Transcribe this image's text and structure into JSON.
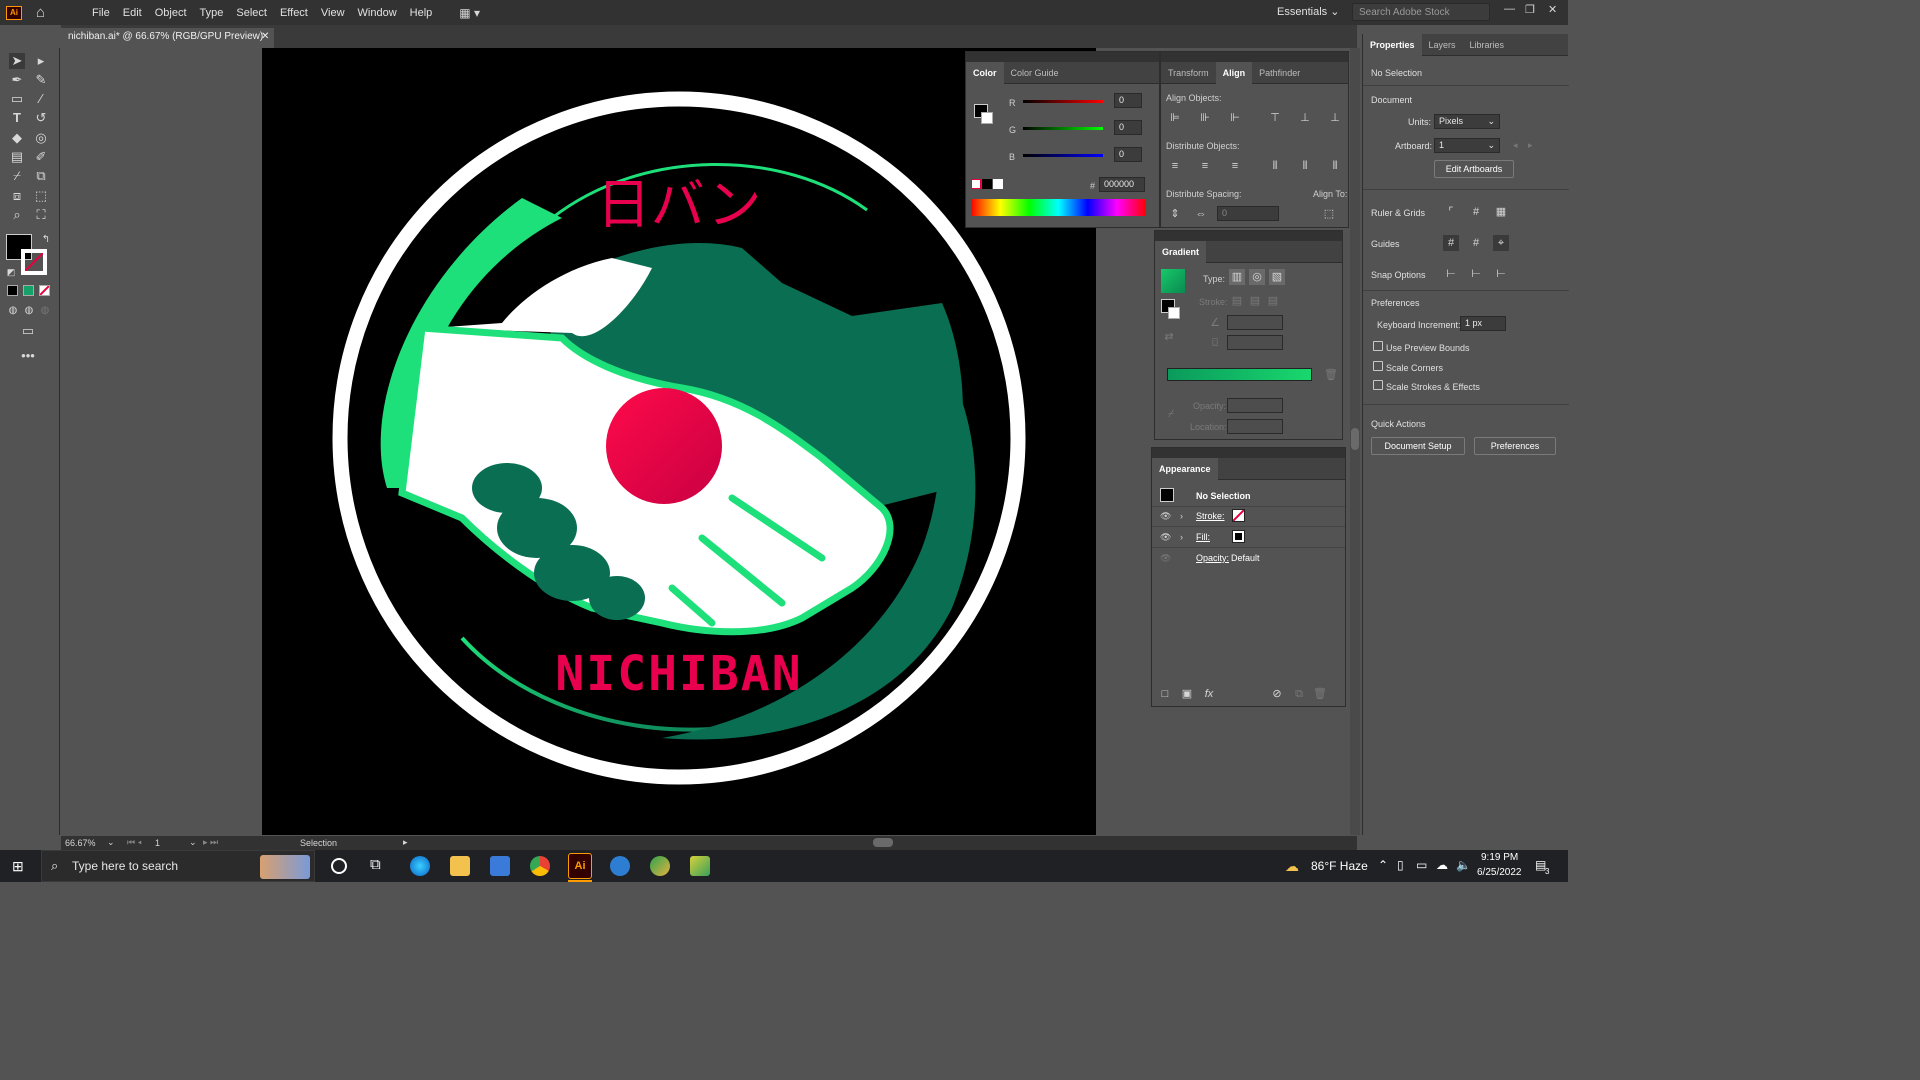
{
  "app": {
    "logo_text": "Ai"
  },
  "menu": [
    "File",
    "Edit",
    "Object",
    "Type",
    "Select",
    "Effect",
    "View",
    "Window",
    "Help"
  ],
  "workspace": {
    "label": "Essentials"
  },
  "stock_search": {
    "placeholder": "Search Adobe Stock"
  },
  "document_tab": {
    "title": "nichiban.ai* @ 66.67% (RGB/GPU Preview)"
  },
  "artwork": {
    "kanji": "日バン",
    "brand": "NICHIBAN",
    "colors": {
      "green_light": "#1ee07a",
      "green_dark": "#0a6e52",
      "red": "#e8004f",
      "white": "#ffffff",
      "black": "#000000"
    }
  },
  "status_bar": {
    "zoom": "66.67%",
    "artboard": "1",
    "tool": "Selection"
  },
  "color_panel": {
    "tabs": [
      "Color",
      "Color Guide"
    ],
    "channels": [
      {
        "label": "R",
        "value": "0"
      },
      {
        "label": "G",
        "value": "0"
      },
      {
        "label": "B",
        "value": "0"
      }
    ],
    "hex_label": "#",
    "hex": "000000"
  },
  "align_panel": {
    "tabs": [
      "Transform",
      "Align",
      "Pathfinder"
    ],
    "align_objects": "Align Objects:",
    "distribute_objects": "Distribute Objects:",
    "distribute_spacing": "Distribute Spacing:",
    "align_to": "Align To:",
    "spacing_value": "0"
  },
  "gradient_panel": {
    "title": "Gradient",
    "type_label": "Type:",
    "stroke_label": "Stroke:",
    "opacity_label": "Opacity:",
    "location_label": "Location:",
    "gradient_start": "#0a9a5c",
    "gradient_end": "#19d86e"
  },
  "appearance_panel": {
    "title": "Appearance",
    "selection": "No Selection",
    "rows": [
      {
        "label": "Stroke:",
        "value": ""
      },
      {
        "label": "Fill:",
        "value": ""
      },
      {
        "label": "Opacity:",
        "value": "Default"
      }
    ]
  },
  "properties_panel": {
    "tabs": [
      "Properties",
      "Layers",
      "Libraries"
    ],
    "selection": "No Selection",
    "document": "Document",
    "units_label": "Units:",
    "units_value": "Pixels",
    "artboard_label": "Artboard:",
    "artboard_value": "1",
    "edit_artboards": "Edit Artboards",
    "ruler_grids": "Ruler & Grids",
    "guides": "Guides",
    "snap_options": "Snap Options",
    "preferences": "Preferences",
    "keyboard_increment_label": "Keyboard Increment:",
    "keyboard_increment_value": "1 px",
    "checkboxes": [
      "Use Preview Bounds",
      "Scale Corners",
      "Scale Strokes & Effects"
    ],
    "quick_actions": "Quick Actions",
    "document_setup": "Document Setup",
    "preferences_button": "Preferences"
  },
  "taskbar": {
    "search_placeholder": "Type here to search",
    "weather": "86°F  Haze",
    "time": "9:19 PM",
    "date": "6/25/2022",
    "notification_count": "3"
  }
}
